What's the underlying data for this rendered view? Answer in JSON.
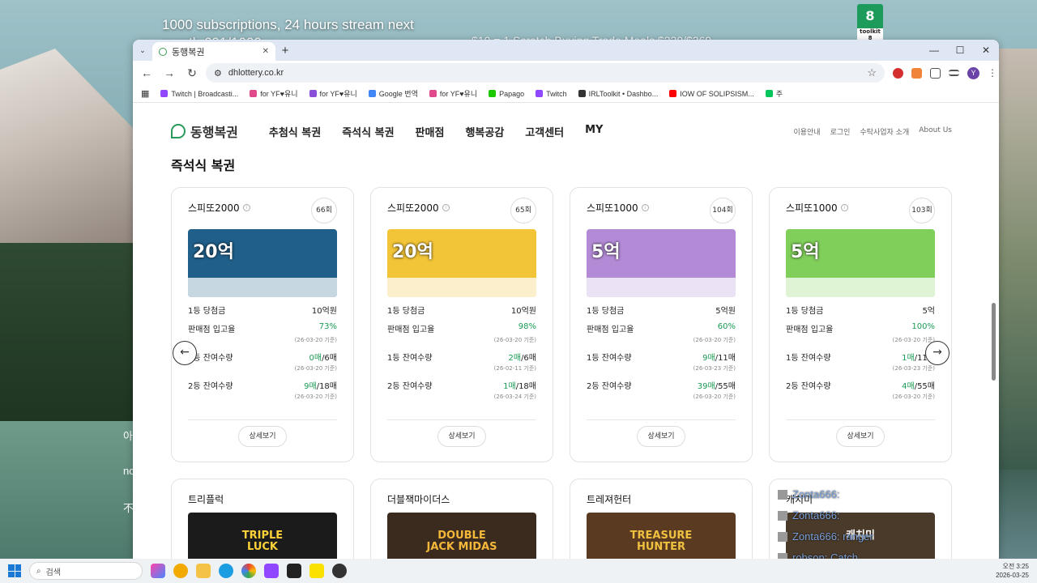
{
  "overlay": {
    "top_text": "1000 subscriptions, 24 hours stream next month 691/1000",
    "second_text": "$10 = 1 Scratch Buying Trade Meals $230/$369",
    "toolkit_label": "8",
    "toolkit_sub": "toolkit 8"
  },
  "side_text": [
    "아",
    "no",
    "不"
  ],
  "browser": {
    "tab_title": "동행복권",
    "url": "dhlottery.co.kr",
    "bookmarks": [
      {
        "label": "Twitch | Broadcasti...",
        "color": "#9146ff"
      },
      {
        "label": "for YF♥유니",
        "color": "#e04a8c"
      },
      {
        "label": "for YF♥유니",
        "color": "#8a4fd8"
      },
      {
        "label": "Google 번역",
        "color": "#4285f4"
      },
      {
        "label": "for YF♥유니",
        "color": "#e04a8c"
      },
      {
        "label": "Papago",
        "color": "#1ec800"
      },
      {
        "label": "Twitch",
        "color": "#9146ff"
      },
      {
        "label": "IRLToolkit • Dashbo...",
        "color": "#333333"
      },
      {
        "label": "IOW OF SOLIPSISM...",
        "color": "#ff0000"
      },
      {
        "label": "주",
        "color": "#03c75a"
      }
    ],
    "avatar": "Y"
  },
  "site": {
    "logo": "동행복권",
    "menu": [
      "추첨식 복권",
      "즉석식 복권",
      "판매점",
      "행복공감",
      "고객센터",
      "MY"
    ],
    "util": [
      "이용안내",
      "로그인",
      "수탁사업자 소개",
      "About Us"
    ],
    "section_title": "즉석식 복권",
    "labels": {
      "first_prize": "1등 당첨금",
      "rate": "판매점 입고율",
      "first_left": "1등 잔여수량",
      "second_left": "2등 잔여수량",
      "detail": "상세보기"
    },
    "cards": [
      {
        "name": "스피또2000",
        "round": "66회",
        "big": "20억",
        "prize": "10억원",
        "rate": "73%",
        "rate_date": "(26-03-20 기준)",
        "first_have": "0매",
        "first_total": "/6매",
        "first_date": "(26-03-20 기준)",
        "second_have": "9매",
        "second_total": "/18매",
        "second_date": "(26-03-20 기준)",
        "bg": "#1f5f8a"
      },
      {
        "name": "스피또2000",
        "round": "65회",
        "big": "20억",
        "prize": "10억원",
        "rate": "98%",
        "rate_date": "(26-03-20 기준)",
        "first_have": "2매",
        "first_total": "/6매",
        "first_date": "(26-02-11 기준)",
        "second_have": "1매",
        "second_total": "/18매",
        "second_date": "(26-03-24 기준)",
        "bg": "#f2c437"
      },
      {
        "name": "스피또1000",
        "round": "104회",
        "big": "5억",
        "prize": "5억원",
        "rate": "60%",
        "rate_date": "(26-03-20 기준)",
        "first_have": "9매",
        "first_total": "/11매",
        "first_date": "(26-03-23 기준)",
        "second_have": "39매",
        "second_total": "/55매",
        "second_date": "(26-03-20 기준)",
        "bg": "#b38ad6"
      },
      {
        "name": "스피또1000",
        "round": "103회",
        "big": "5억",
        "prize": "5억",
        "rate": "100%",
        "rate_date": "(26-03-20 기준)",
        "first_have": "1매",
        "first_total": "/11매",
        "first_date": "(26-03-23 기준)",
        "second_have": "4매",
        "second_total": "/55매",
        "second_date": "(26-03-20 기준)",
        "bg": "#7fcf5a"
      }
    ],
    "games": [
      {
        "name": "트리플럭",
        "title": "TRIPLE LUCK",
        "bg": "#1b1b1b",
        "fg": "#ffd23a"
      },
      {
        "name": "더블잭마이더스",
        "title": "DOUBLE JACK MIDAS",
        "bg": "#3a2b1e",
        "fg": "#f5b83a"
      },
      {
        "name": "트레져헌터",
        "title": "TREASURE HUNTER",
        "bg": "#5a3b22",
        "fg": "#f0c040"
      },
      {
        "name": "캐치미",
        "title": "캐치미",
        "bg": "#4a3a2a",
        "fg": "#ffffff"
      }
    ]
  },
  "chat": [
    "Zonta666:",
    "Zonta666:",
    "Zonta666: ranger",
    "robson: Catch"
  ],
  "taskbar": {
    "search_placeholder": "검색",
    "time": "오전 3:25",
    "date": "2026-03-25"
  }
}
